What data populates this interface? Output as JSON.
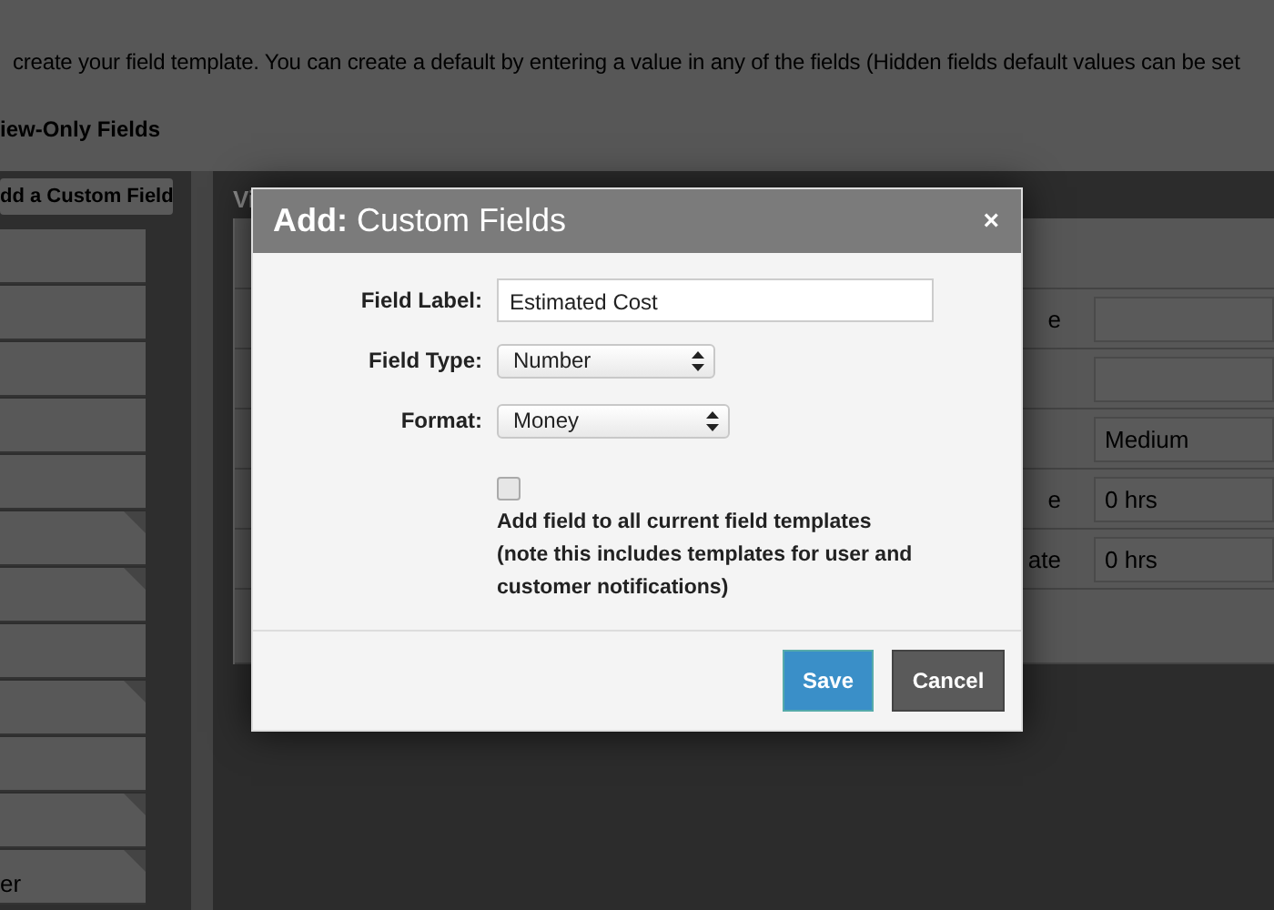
{
  "page": {
    "intro": "create your field template. You can create a default by entering a value in any of the fields (Hidden fields default values can be set",
    "section_title": "iew-Only Fields"
  },
  "sidebar": {
    "button": "dd a Custom Field",
    "items": [
      {
        "folded": false
      },
      {
        "folded": false
      },
      {
        "folded": false
      },
      {
        "folded": false
      },
      {
        "folded": false
      },
      {
        "folded": true
      },
      {
        "folded": true
      },
      {
        "folded": false
      },
      {
        "folded": true
      },
      {
        "folded": false
      },
      {
        "folded": true
      },
      {
        "folded": true,
        "label": "er"
      }
    ]
  },
  "panel": {
    "title": "Vi",
    "rows": [
      {
        "kind": "header"
      },
      {
        "kind": "input",
        "label": "e"
      },
      {
        "kind": "input"
      },
      {
        "kind": "input",
        "value": "Medium"
      },
      {
        "kind": "input",
        "label": "e",
        "value": "0 hrs"
      },
      {
        "kind": "input",
        "label": "ate",
        "value": "0 hrs"
      },
      {
        "kind": "footer"
      }
    ]
  },
  "modal": {
    "title": "**Add:** Custom Fields",
    "close": "×",
    "fields": [
      {
        "label": "Field Label:",
        "kind": "text",
        "value": "Estimated Cost"
      },
      {
        "label": "Field Type:",
        "kind": "select",
        "value": "Number"
      },
      {
        "label": "Format:",
        "kind": "select",
        "value": "Money"
      }
    ],
    "apply_all": {
      "checked": false,
      "label": "Add field to all current field templates",
      "note": "(note this includes templates for user and customer notifications)"
    },
    "buttons": [
      {
        "label": "Save",
        "kind": "primary"
      },
      {
        "label": "Cancel",
        "kind": "secondary"
      }
    ]
  }
}
